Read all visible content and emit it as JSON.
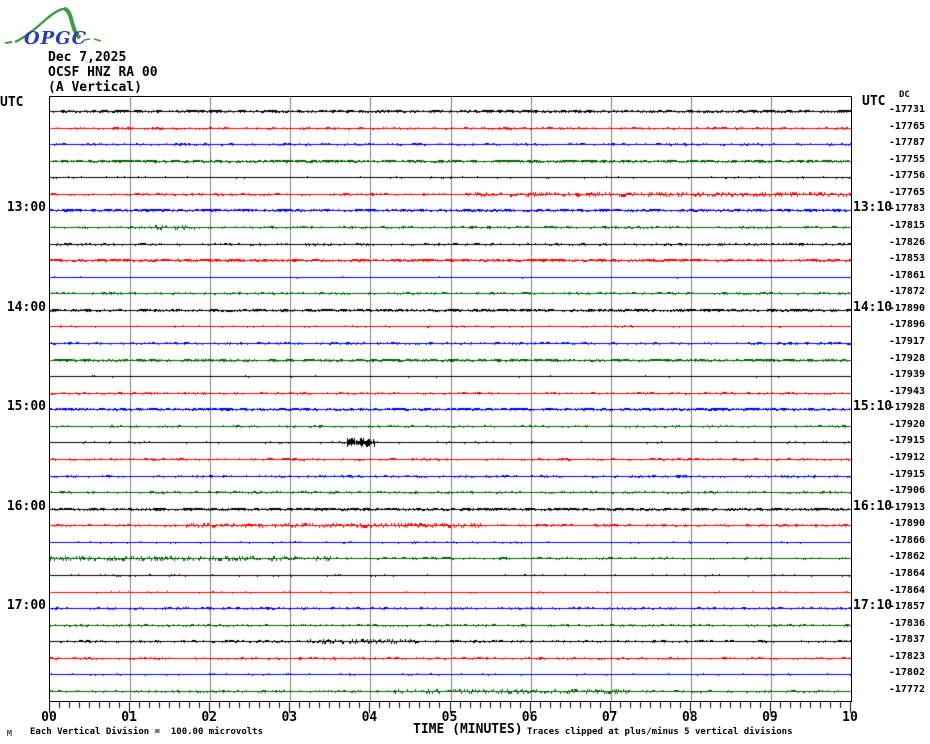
{
  "logo": {
    "text": "OPGC",
    "text_color": "#2b3fae",
    "curve_color": "#3f9e44"
  },
  "header": {
    "date": "Dec 7,2025",
    "station": "OCSF HNZ RA 00",
    "component": "(A Vertical)"
  },
  "axes": {
    "left_title": "UTC",
    "right_title": "UTC",
    "right_subtitle": "DC",
    "x_label": "TIME (MINUTES)"
  },
  "footer": {
    "left_note": "Each Vertical Division =  100.00 microvolts",
    "right_note": "Traces clipped at plus/minus 5 vertical divisions",
    "corner_mark": "M"
  },
  "colors": {
    "black": "#000000",
    "red": "#ff0000",
    "blue": "#0000ff",
    "green": "#006600",
    "grid": "#808080",
    "border": "#000000"
  },
  "chart_data": {
    "type": "line",
    "subtype": "helicorder",
    "title": "OCSF HNZ RA 00 (A Vertical) Dec 7,2025",
    "x_axis": {
      "label": "TIME (MINUTES)",
      "ticks": [
        "00",
        "01",
        "02",
        "03",
        "04",
        "05",
        "06",
        "07",
        "08",
        "09",
        "10"
      ],
      "range_minutes": [
        0,
        10
      ],
      "minor_tick_intervals_per_minute": 8,
      "grid": "vertical-gray-lines-each-minute"
    },
    "row_count": 36,
    "color_cycle": [
      "black",
      "red",
      "blue",
      "green"
    ],
    "minutes_per_row": 10,
    "rows": [
      {
        "dc": "-17731",
        "color": "black",
        "noise": 3,
        "left": "",
        "right": "",
        "bursts": []
      },
      {
        "dc": "-17765",
        "color": "red",
        "noise": 2,
        "left": "",
        "right": "",
        "bursts": []
      },
      {
        "dc": "-17787",
        "color": "blue",
        "noise": 2,
        "left": "",
        "right": "",
        "bursts": []
      },
      {
        "dc": "-17755",
        "color": "green",
        "noise": 3,
        "left": "",
        "right": "",
        "bursts": []
      },
      {
        "dc": "-17756",
        "color": "black",
        "noise": 1,
        "left": "",
        "right": "",
        "bursts": []
      },
      {
        "dc": "-17765",
        "color": "red",
        "noise": 2,
        "left": "",
        "right": "",
        "bursts": [
          [
            5.3,
            10,
            1
          ]
        ]
      },
      {
        "dc": "-17783",
        "color": "blue",
        "noise": 3,
        "left": "13:00",
        "right": "13:10",
        "bursts": []
      },
      {
        "dc": "-17815",
        "color": "green",
        "noise": 2,
        "left": "",
        "right": "",
        "bursts": [
          [
            1.2,
            1.8,
            1
          ]
        ]
      },
      {
        "dc": "-17826",
        "color": "black",
        "noise": 2,
        "left": "",
        "right": "",
        "bursts": []
      },
      {
        "dc": "-17853",
        "color": "red",
        "noise": 3,
        "left": "",
        "right": "",
        "bursts": []
      },
      {
        "dc": "-17861",
        "color": "blue",
        "noise": 0,
        "left": "",
        "right": "",
        "bursts": []
      },
      {
        "dc": "-17872",
        "color": "green",
        "noise": 2,
        "left": "",
        "right": "",
        "bursts": []
      },
      {
        "dc": "-17890",
        "color": "black",
        "noise": 3,
        "left": "14:00",
        "right": "14:10",
        "bursts": []
      },
      {
        "dc": "-17896",
        "color": "red",
        "noise": 1,
        "left": "",
        "right": "",
        "bursts": []
      },
      {
        "dc": "-17917",
        "color": "blue",
        "noise": 2,
        "left": "",
        "right": "",
        "bursts": []
      },
      {
        "dc": "-17928",
        "color": "green",
        "noise": 3,
        "left": "",
        "right": "",
        "bursts": []
      },
      {
        "dc": "-17939",
        "color": "black",
        "noise": 0,
        "left": "",
        "right": "",
        "bursts": []
      },
      {
        "dc": "-17943",
        "color": "red",
        "noise": 2,
        "left": "",
        "right": "",
        "bursts": []
      },
      {
        "dc": "-17928",
        "color": "blue",
        "noise": 3,
        "left": "15:00",
        "right": "15:10",
        "bursts": []
      },
      {
        "dc": "-17920",
        "color": "green",
        "noise": 2,
        "left": "",
        "right": "",
        "bursts": []
      },
      {
        "dc": "-17915",
        "color": "black",
        "noise": 1,
        "left": "",
        "right": "",
        "bursts": [
          [
            3.7,
            4.05,
            3
          ]
        ]
      },
      {
        "dc": "-17912",
        "color": "red",
        "noise": 2,
        "left": "",
        "right": "",
        "bursts": []
      },
      {
        "dc": "-17915",
        "color": "blue",
        "noise": 2,
        "left": "",
        "right": "",
        "bursts": []
      },
      {
        "dc": "-17906",
        "color": "green",
        "noise": 2,
        "left": "",
        "right": "",
        "bursts": []
      },
      {
        "dc": "-17913",
        "color": "black",
        "noise": 3,
        "left": "16:00",
        "right": "16:10",
        "bursts": []
      },
      {
        "dc": "-17890",
        "color": "red",
        "noise": 2,
        "left": "",
        "right": "",
        "bursts": [
          [
            1.5,
            5.5,
            1
          ]
        ]
      },
      {
        "dc": "-17866",
        "color": "blue",
        "noise": 1,
        "left": "",
        "right": "",
        "bursts": []
      },
      {
        "dc": "-17862",
        "color": "green",
        "noise": 2,
        "left": "",
        "right": "",
        "bursts": [
          [
            0,
            3.5,
            1
          ]
        ]
      },
      {
        "dc": "-17864",
        "color": "black",
        "noise": 1,
        "left": "",
        "right": "",
        "bursts": []
      },
      {
        "dc": "-17864",
        "color": "red",
        "noise": 1,
        "left": "",
        "right": "",
        "bursts": []
      },
      {
        "dc": "-17857",
        "color": "blue",
        "noise": 2,
        "left": "17:00",
        "right": "17:10",
        "bursts": []
      },
      {
        "dc": "-17836",
        "color": "green",
        "noise": 2,
        "left": "",
        "right": "",
        "bursts": []
      },
      {
        "dc": "-17837",
        "color": "black",
        "noise": 2,
        "left": "",
        "right": "",
        "bursts": [
          [
            3.2,
            4.6,
            1
          ]
        ]
      },
      {
        "dc": "-17823",
        "color": "red",
        "noise": 2,
        "left": "",
        "right": "",
        "bursts": []
      },
      {
        "dc": "-17802",
        "color": "blue",
        "noise": 1,
        "left": "",
        "right": "",
        "bursts": []
      },
      {
        "dc": "-17772",
        "color": "green",
        "noise": 2,
        "left": "",
        "right": "",
        "bursts": [
          [
            4.3,
            7.2,
            1
          ]
        ]
      }
    ],
    "annotations": [
      {
        "row": 21,
        "minute": 3.85,
        "note": "small seismic burst on black trace"
      }
    ]
  }
}
